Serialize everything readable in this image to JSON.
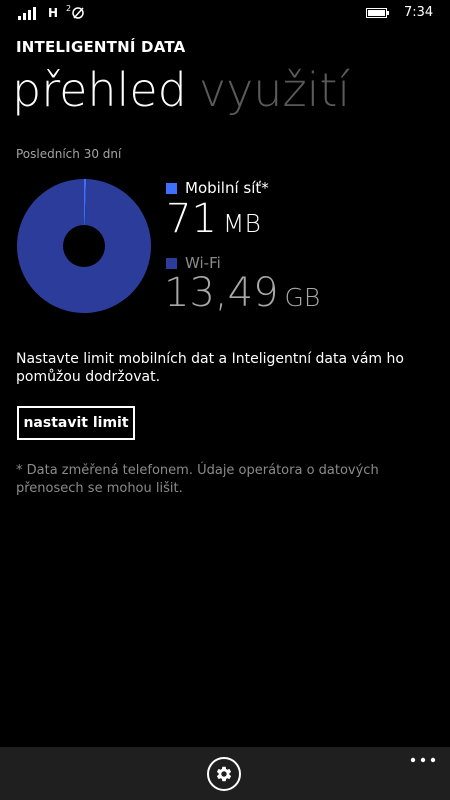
{
  "status_bar": {
    "network": "H",
    "sim": "2",
    "time": "7:34"
  },
  "app": {
    "title": "INTELIGENTNÍ DATA"
  },
  "pivot": {
    "active": "přehled",
    "inactive": "využití"
  },
  "usage": {
    "period": "Posledních 30 dní",
    "mobile": {
      "label": "Mobilní síť*",
      "value": "71",
      "unit": "MB",
      "color": "#3f6fff"
    },
    "wifi": {
      "label": "Wi-Fi",
      "value": "13,49",
      "unit": "GB",
      "color": "#2b3c9a"
    }
  },
  "chart_data": {
    "type": "pie",
    "categories": [
      "Mobilní síť*",
      "Wi-Fi"
    ],
    "values": [
      71,
      13813.76
    ],
    "units": "MB",
    "colors": [
      "#3f6fff",
      "#2b3c9a"
    ]
  },
  "limit": {
    "message": "Nastavte limit mobilních dat a Inteligentní data vám ho pomůžou dodržovat.",
    "button_label": "nastavit limit"
  },
  "footnote": "* Data změřená telefonem. Údaje operátora o datových přenosech se mohou lišit.",
  "app_bar": {
    "settings_icon": "gear-icon",
    "more_icon": "ellipsis-icon"
  }
}
